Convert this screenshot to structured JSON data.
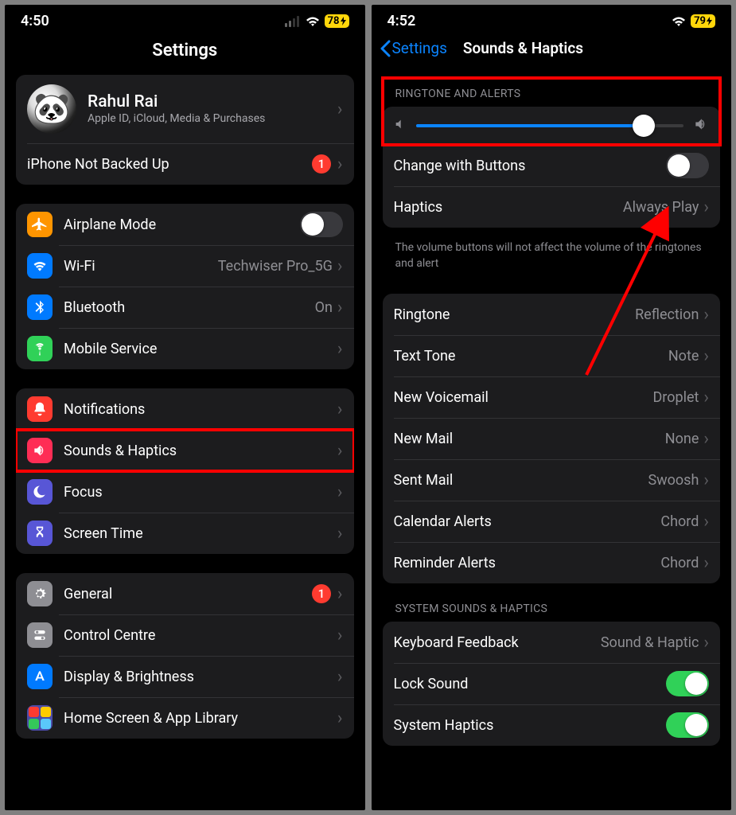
{
  "left": {
    "status_time": "4:50",
    "battery": "78",
    "title": "Settings",
    "profile": {
      "name": "Rahul Rai",
      "subtitle": "Apple ID, iCloud, Media & Purchases"
    },
    "backup_warning": {
      "label": "iPhone Not Backed Up",
      "badge": "1"
    },
    "group1": {
      "airplane": "Airplane Mode",
      "wifi": {
        "label": "Wi-Fi",
        "value": "Techwiser Pro_5G"
      },
      "bluetooth": {
        "label": "Bluetooth",
        "value": "On"
      },
      "mobile": "Mobile Service"
    },
    "group2": {
      "notifications": "Notifications",
      "sounds": "Sounds & Haptics",
      "focus": "Focus",
      "screentime": "Screen Time"
    },
    "group3": {
      "general": {
        "label": "General",
        "badge": "1"
      },
      "control": "Control Centre",
      "display": "Display & Brightness",
      "home": "Home Screen & App Library"
    }
  },
  "right": {
    "status_time": "4:52",
    "battery": "79",
    "back": "Settings",
    "title": "Sounds & Haptics",
    "ringtone_header": "RINGTONE AND ALERTS",
    "slider_pct": 85,
    "change_buttons": "Change with Buttons",
    "haptics": {
      "label": "Haptics",
      "value": "Always Play"
    },
    "footer1": "The volume buttons will not affect the volume of the ringtones and alert",
    "sounds": {
      "ringtone": {
        "label": "Ringtone",
        "value": "Reflection"
      },
      "texttone": {
        "label": "Text Tone",
        "value": "Note"
      },
      "voicemail": {
        "label": "New Voicemail",
        "value": "Droplet"
      },
      "newmail": {
        "label": "New Mail",
        "value": "None"
      },
      "sentmail": {
        "label": "Sent Mail",
        "value": "Swoosh"
      },
      "calendar": {
        "label": "Calendar Alerts",
        "value": "Chord"
      },
      "reminder": {
        "label": "Reminder Alerts",
        "value": "Chord"
      }
    },
    "system_header": "SYSTEM SOUNDS & HAPTICS",
    "system": {
      "keyboard": {
        "label": "Keyboard Feedback",
        "value": "Sound & Haptic"
      },
      "lock": "Lock Sound",
      "haptics": "System Haptics"
    }
  }
}
